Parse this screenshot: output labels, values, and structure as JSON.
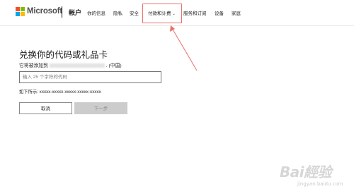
{
  "header": {
    "brand": "Microsoft",
    "account": "帐户",
    "nav": {
      "info": "你的信息",
      "privacy": "隐私",
      "security": "安全",
      "payment": "付款和计费",
      "services": "服务和订阅",
      "devices": "设备",
      "family": "家庭"
    },
    "highlight_color": "#e8716b",
    "logo_colors": [
      "#f25022",
      "#7fba00",
      "#00a4ef",
      "#ffb900"
    ]
  },
  "main": {
    "title": "兑换你的代码或礼品卡",
    "add_to_prefix": "它将被添加到",
    "add_to_suffix": ". (中国)",
    "code_placeholder": "输入 25 个字符的代码",
    "example": "如下所示: xxxxx-xxxxx-xxxxx-xxxxx-xxxxx",
    "cancel_label": "取消",
    "next_label": "下一步"
  },
  "watermark": {
    "text": "Bai經验",
    "sub": "jingyan.baidu.com"
  }
}
